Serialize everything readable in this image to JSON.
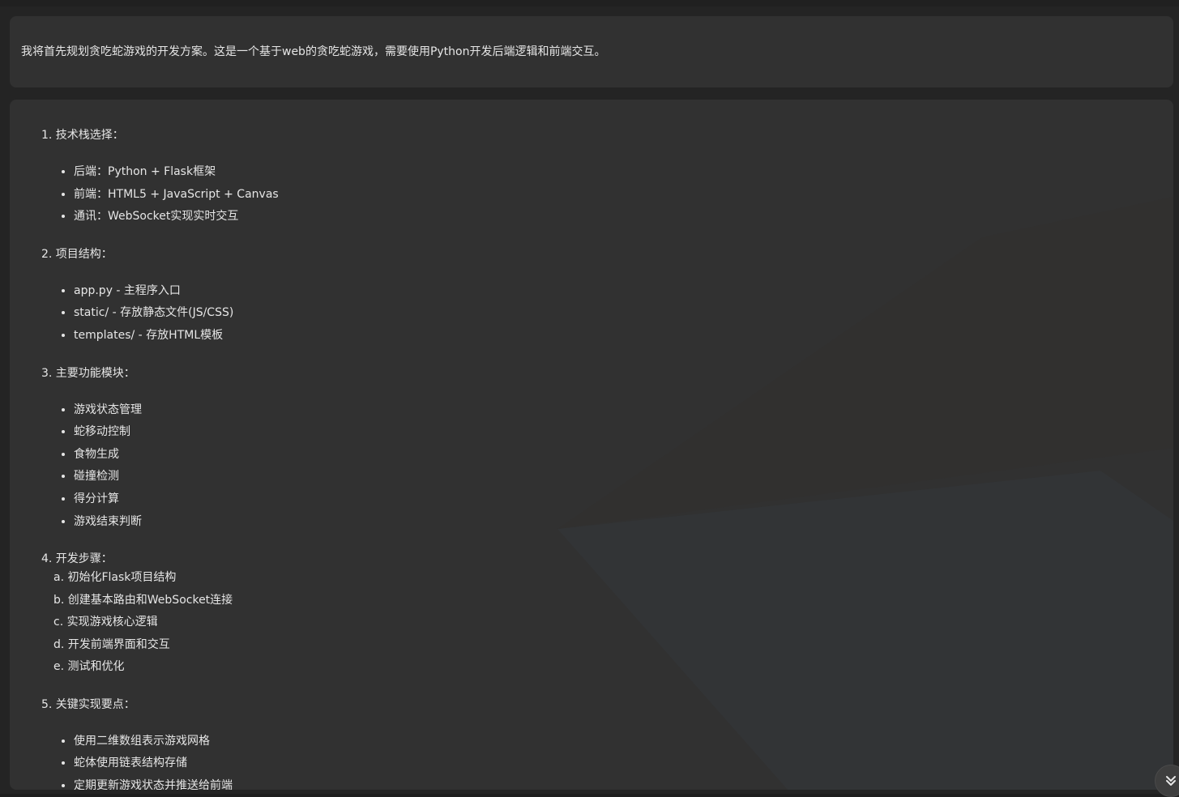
{
  "intro": {
    "text": "我将首先规划贪吃蛇游戏的开发方案。这是一个基于web的贪吃蛇游戏，需要使用Python开发后端逻辑和前端交互。"
  },
  "plan": {
    "sections": [
      {
        "heading": "1. 技术栈选择：",
        "items": [
          "后端：Python + Flask框架",
          "前端：HTML5 + JavaScript + Canvas",
          "通讯：WebSocket实现实时交互"
        ]
      },
      {
        "heading": "2. 项目结构：",
        "items": [
          "app.py - 主程序入口",
          "static/ - 存放静态文件(JS/CSS)",
          "templates/ - 存放HTML模板"
        ]
      },
      {
        "heading": "3. 主要功能模块：",
        "items": [
          "游戏状态管理",
          "蛇移动控制",
          "食物生成",
          "碰撞检测",
          "得分计算",
          "游戏结束判断"
        ]
      },
      {
        "heading": "4. 开发步骤：",
        "steps": [
          "a. 初始化Flask项目结构",
          "b. 创建基本路由和WebSocket连接",
          "c. 实现游戏核心逻辑",
          "d. 开发前端界面和交互",
          "e. 测试和优化"
        ]
      },
      {
        "heading": "5. 关键实现要点：",
        "items": [
          "使用二维数组表示游戏网格",
          "蛇体使用链表结构存储",
          "定期更新游戏状态并推送给前端"
        ]
      }
    ]
  },
  "controls": {
    "scroll_down_icon": "double-chevron-down-icon"
  },
  "colors": {
    "background": "#242424",
    "card": "#313131",
    "text": "#e6e6e6"
  }
}
